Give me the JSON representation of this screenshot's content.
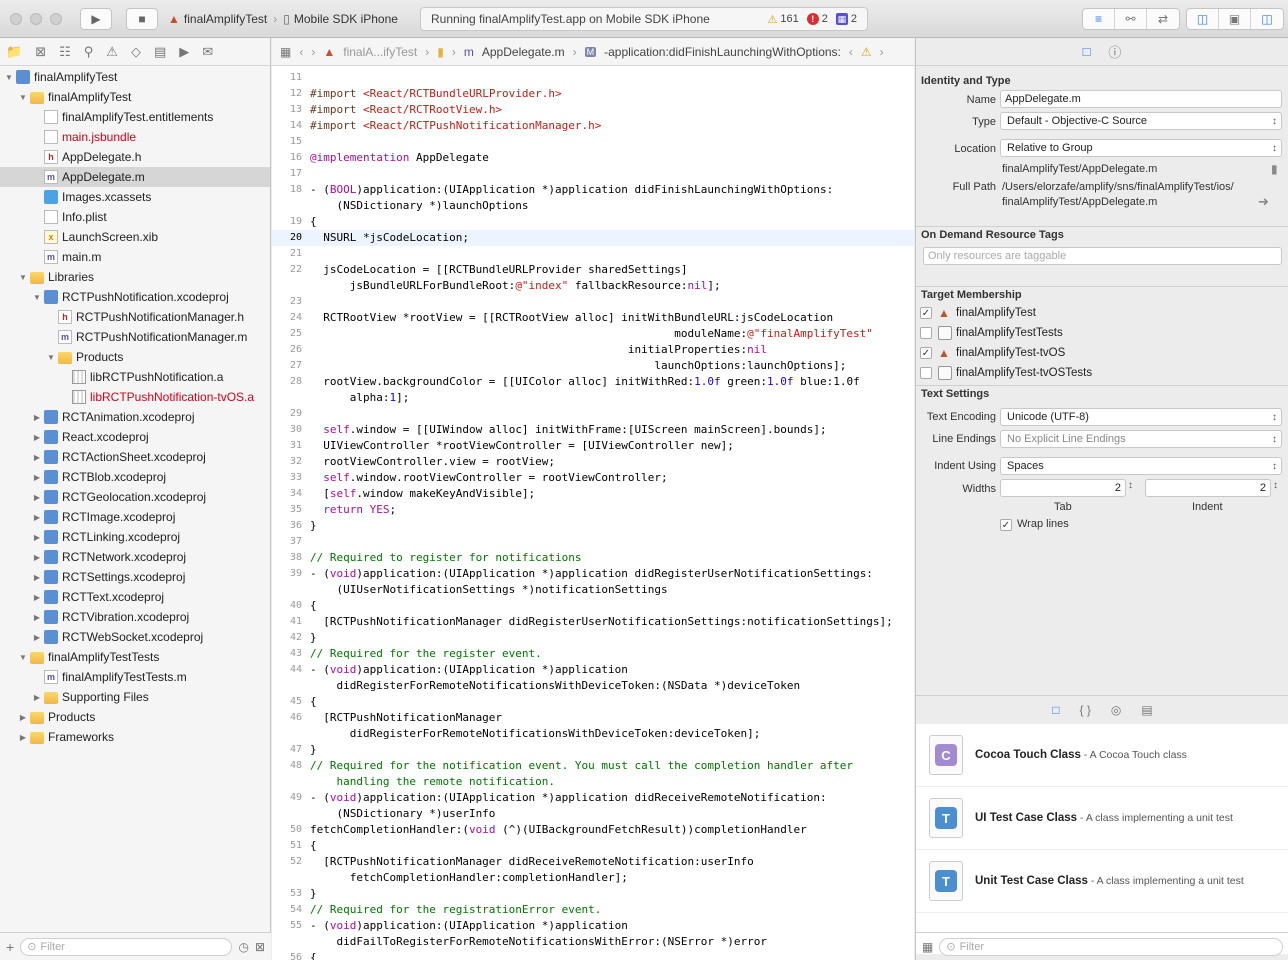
{
  "toolbar": {
    "scheme": "finalAmplifyTest",
    "destination": "Mobile SDK iPhone",
    "status": "Running finalAmplifyTest.app on Mobile SDK iPhone",
    "warnings": "161",
    "errors": "2",
    "issues": "2"
  },
  "navigator": {
    "filter_placeholder": "Filter",
    "rows": [
      {
        "label": "finalAmplifyTest",
        "indent": 0,
        "disc": "▼",
        "icon": "proj",
        "cls": ""
      },
      {
        "label": "finalAmplifyTest",
        "indent": 1,
        "disc": "▼",
        "icon": "folder",
        "cls": ""
      },
      {
        "label": "finalAmplifyTest.entitlements",
        "indent": 2,
        "disc": "",
        "icon": "gen",
        "cls": ""
      },
      {
        "label": "main.jsbundle",
        "indent": 2,
        "disc": "",
        "icon": "gen",
        "cls": "red"
      },
      {
        "label": "AppDelegate.h",
        "indent": 2,
        "disc": "",
        "icon": "hdr",
        "cls": ""
      },
      {
        "label": "AppDelegate.m",
        "indent": 2,
        "disc": "",
        "icon": "impl",
        "cls": "sel"
      },
      {
        "label": "Images.xcassets",
        "indent": 2,
        "disc": "",
        "icon": "assets",
        "cls": ""
      },
      {
        "label": "Info.plist",
        "indent": 2,
        "disc": "",
        "icon": "gen",
        "cls": ""
      },
      {
        "label": "LaunchScreen.xib",
        "indent": 2,
        "disc": "",
        "icon": "xib",
        "cls": ""
      },
      {
        "label": "main.m",
        "indent": 2,
        "disc": "",
        "icon": "impl",
        "cls": ""
      },
      {
        "label": "Libraries",
        "indent": 1,
        "disc": "▼",
        "icon": "folder",
        "cls": ""
      },
      {
        "label": "RCTPushNotification.xcodeproj",
        "indent": 2,
        "disc": "▼",
        "icon": "proj",
        "cls": ""
      },
      {
        "label": "RCTPushNotificationManager.h",
        "indent": 3,
        "disc": "",
        "icon": "hdr",
        "cls": ""
      },
      {
        "label": "RCTPushNotificationManager.m",
        "indent": 3,
        "disc": "",
        "icon": "impl",
        "cls": ""
      },
      {
        "label": "Products",
        "indent": 3,
        "disc": "▼",
        "icon": "folder",
        "cls": ""
      },
      {
        "label": "libRCTPushNotification.a",
        "indent": 4,
        "disc": "",
        "icon": "lib",
        "cls": ""
      },
      {
        "label": "libRCTPushNotification-tvOS.a",
        "indent": 4,
        "disc": "",
        "icon": "lib",
        "cls": "red"
      },
      {
        "label": "RCTAnimation.xcodeproj",
        "indent": 2,
        "disc": "▶",
        "icon": "proj",
        "cls": ""
      },
      {
        "label": "React.xcodeproj",
        "indent": 2,
        "disc": "▶",
        "icon": "proj",
        "cls": ""
      },
      {
        "label": "RCTActionSheet.xcodeproj",
        "indent": 2,
        "disc": "▶",
        "icon": "proj",
        "cls": ""
      },
      {
        "label": "RCTBlob.xcodeproj",
        "indent": 2,
        "disc": "▶",
        "icon": "proj",
        "cls": ""
      },
      {
        "label": "RCTGeolocation.xcodeproj",
        "indent": 2,
        "disc": "▶",
        "icon": "proj",
        "cls": ""
      },
      {
        "label": "RCTImage.xcodeproj",
        "indent": 2,
        "disc": "▶",
        "icon": "proj",
        "cls": ""
      },
      {
        "label": "RCTLinking.xcodeproj",
        "indent": 2,
        "disc": "▶",
        "icon": "proj",
        "cls": ""
      },
      {
        "label": "RCTNetwork.xcodeproj",
        "indent": 2,
        "disc": "▶",
        "icon": "proj",
        "cls": ""
      },
      {
        "label": "RCTSettings.xcodeproj",
        "indent": 2,
        "disc": "▶",
        "icon": "proj",
        "cls": ""
      },
      {
        "label": "RCTText.xcodeproj",
        "indent": 2,
        "disc": "▶",
        "icon": "proj",
        "cls": ""
      },
      {
        "label": "RCTVibration.xcodeproj",
        "indent": 2,
        "disc": "▶",
        "icon": "proj",
        "cls": ""
      },
      {
        "label": "RCTWebSocket.xcodeproj",
        "indent": 2,
        "disc": "▶",
        "icon": "proj",
        "cls": ""
      },
      {
        "label": "finalAmplifyTestTests",
        "indent": 1,
        "disc": "▼",
        "icon": "folder",
        "cls": ""
      },
      {
        "label": "finalAmplifyTestTests.m",
        "indent": 2,
        "disc": "",
        "icon": "impl",
        "cls": ""
      },
      {
        "label": "Supporting Files",
        "indent": 2,
        "disc": "▶",
        "icon": "folder",
        "cls": ""
      },
      {
        "label": "Products",
        "indent": 1,
        "disc": "▶",
        "icon": "folder",
        "cls": ""
      },
      {
        "label": "Frameworks",
        "indent": 1,
        "disc": "▶",
        "icon": "folder",
        "cls": ""
      }
    ]
  },
  "jumpbar": {
    "project": "finalA...ifyTest",
    "file": "AppDelegate.m",
    "method": "-application:didFinishLaunchingWithOptions:"
  },
  "editor": {
    "current_line": "20",
    "lines": [
      {
        "n": "11",
        "t": ""
      },
      {
        "n": "12",
        "t": "#import <React/RCTBundleURLProvider.h>"
      },
      {
        "n": "13",
        "t": "#import <React/RCTRootView.h>"
      },
      {
        "n": "14",
        "t": "#import <React/RCTPushNotificationManager.h>"
      },
      {
        "n": "15",
        "t": ""
      },
      {
        "n": "16",
        "t": "@implementation AppDelegate"
      },
      {
        "n": "17",
        "t": ""
      },
      {
        "n": "18",
        "t": "- (BOOL)application:(UIApplication *)application didFinishLaunchingWithOptions:"
      },
      {
        "n": "",
        "t": "    (NSDictionary *)launchOptions"
      },
      {
        "n": "19",
        "t": "{"
      },
      {
        "n": "20",
        "t": "  NSURL *jsCodeLocation;"
      },
      {
        "n": "21",
        "t": ""
      },
      {
        "n": "22",
        "t": "  jsCodeLocation = [[RCTBundleURLProvider sharedSettings]"
      },
      {
        "n": "",
        "t": "      jsBundleURLForBundleRoot:@\"index\" fallbackResource:nil];"
      },
      {
        "n": "23",
        "t": ""
      },
      {
        "n": "24",
        "t": "  RCTRootView *rootView = [[RCTRootView alloc] initWithBundleURL:jsCodeLocation"
      },
      {
        "n": "25",
        "t": "                                                       moduleName:@\"finalAmplifyTest\""
      },
      {
        "n": "26",
        "t": "                                                initialProperties:nil"
      },
      {
        "n": "27",
        "t": "                                                    launchOptions:launchOptions];"
      },
      {
        "n": "28",
        "t": "  rootView.backgroundColor = [[UIColor alloc] initWithRed:1.0f green:1.0f blue:1.0f"
      },
      {
        "n": "",
        "t": "      alpha:1];"
      },
      {
        "n": "29",
        "t": ""
      },
      {
        "n": "30",
        "t": "  self.window = [[UIWindow alloc] initWithFrame:[UIScreen mainScreen].bounds];"
      },
      {
        "n": "31",
        "t": "  UIViewController *rootViewController = [UIViewController new];"
      },
      {
        "n": "32",
        "t": "  rootViewController.view = rootView;"
      },
      {
        "n": "33",
        "t": "  self.window.rootViewController = rootViewController;"
      },
      {
        "n": "34",
        "t": "  [self.window makeKeyAndVisible];"
      },
      {
        "n": "35",
        "t": "  return YES;"
      },
      {
        "n": "36",
        "t": "}"
      },
      {
        "n": "37",
        "t": ""
      },
      {
        "n": "38",
        "t": "// Required to register for notifications"
      },
      {
        "n": "39",
        "t": "- (void)application:(UIApplication *)application didRegisterUserNotificationSettings:"
      },
      {
        "n": "",
        "t": "    (UIUserNotificationSettings *)notificationSettings"
      },
      {
        "n": "40",
        "t": "{"
      },
      {
        "n": "41",
        "t": "  [RCTPushNotificationManager didRegisterUserNotificationSettings:notificationSettings];"
      },
      {
        "n": "42",
        "t": "}"
      },
      {
        "n": "43",
        "t": "// Required for the register event."
      },
      {
        "n": "44",
        "t": "- (void)application:(UIApplication *)application"
      },
      {
        "n": "",
        "t": "    didRegisterForRemoteNotificationsWithDeviceToken:(NSData *)deviceToken"
      },
      {
        "n": "45",
        "t": "{"
      },
      {
        "n": "46",
        "t": "  [RCTPushNotificationManager"
      },
      {
        "n": "",
        "t": "      didRegisterForRemoteNotificationsWithDeviceToken:deviceToken];"
      },
      {
        "n": "47",
        "t": "}"
      },
      {
        "n": "48",
        "t": "// Required for the notification event. You must call the completion handler after"
      },
      {
        "n": "",
        "t": "    handling the remote notification."
      },
      {
        "n": "49",
        "t": "- (void)application:(UIApplication *)application didReceiveRemoteNotification:"
      },
      {
        "n": "",
        "t": "    (NSDictionary *)userInfo"
      },
      {
        "n": "50",
        "t": "fetchCompletionHandler:(void (^)(UIBackgroundFetchResult))completionHandler"
      },
      {
        "n": "51",
        "t": "{"
      },
      {
        "n": "52",
        "t": "  [RCTPushNotificationManager didReceiveRemoteNotification:userInfo"
      },
      {
        "n": "",
        "t": "      fetchCompletionHandler:completionHandler];"
      },
      {
        "n": "53",
        "t": "}"
      },
      {
        "n": "54",
        "t": "// Required for the registrationError event."
      },
      {
        "n": "55",
        "t": "- (void)application:(UIApplication *)application"
      },
      {
        "n": "",
        "t": "    didFailToRegisterForRemoteNotificationsWithError:(NSError *)error"
      },
      {
        "n": "56",
        "t": "{"
      }
    ]
  },
  "inspector": {
    "identity": {
      "header": "Identity and Type",
      "name_label": "Name",
      "name_value": "AppDelegate.m",
      "type_label": "Type",
      "type_value": "Default - Objective-C Source",
      "location_label": "Location",
      "location_value": "Relative to Group",
      "relative_path": "finalAmplifyTest/AppDelegate.m",
      "fullpath_label": "Full Path",
      "fullpath_line1": "/Users/elorzafe/amplify/sns/finalAmplifyTest/ios/",
      "fullpath_line2": "finalAmplifyTest/AppDelegate.m"
    },
    "odr": {
      "header": "On Demand Resource Tags",
      "placeholder": "Only resources are taggable"
    },
    "targets": {
      "header": "Target Membership",
      "items": [
        {
          "label": "finalAmplifyTest",
          "checked": "✓",
          "app": true
        },
        {
          "label": "finalAmplifyTestTests",
          "checked": "",
          "app": false
        },
        {
          "label": "finalAmplifyTest-tvOS",
          "checked": "✓",
          "app": true
        },
        {
          "label": "finalAmplifyTest-tvOSTests",
          "checked": "",
          "app": false
        }
      ]
    },
    "text": {
      "header": "Text Settings",
      "encoding_label": "Text Encoding",
      "encoding_value": "Unicode (UTF-8)",
      "endings_label": "Line Endings",
      "endings_value": "No Explicit Line Endings",
      "indent_label": "Indent Using",
      "indent_value": "Spaces",
      "widths_label": "Widths",
      "tab_value": "2",
      "tab_label": "Tab",
      "indent_width_value": "2",
      "indent_width_label": "Indent",
      "wrap_label": "Wrap lines",
      "wrap_checked": "✓"
    },
    "library": {
      "filter_placeholder": "Filter",
      "items": [
        {
          "letter": "C",
          "color": "#a38bd0",
          "title": "Cocoa Touch Class",
          "desc": " - A Cocoa Touch class"
        },
        {
          "letter": "T",
          "color": "#4b8fd1",
          "title": "UI Test Case Class",
          "desc": " - A class implementing a unit test"
        },
        {
          "letter": "T",
          "color": "#4b8fd1",
          "title": "Unit Test Case Class",
          "desc": " - A class implementing a unit test"
        }
      ]
    }
  }
}
